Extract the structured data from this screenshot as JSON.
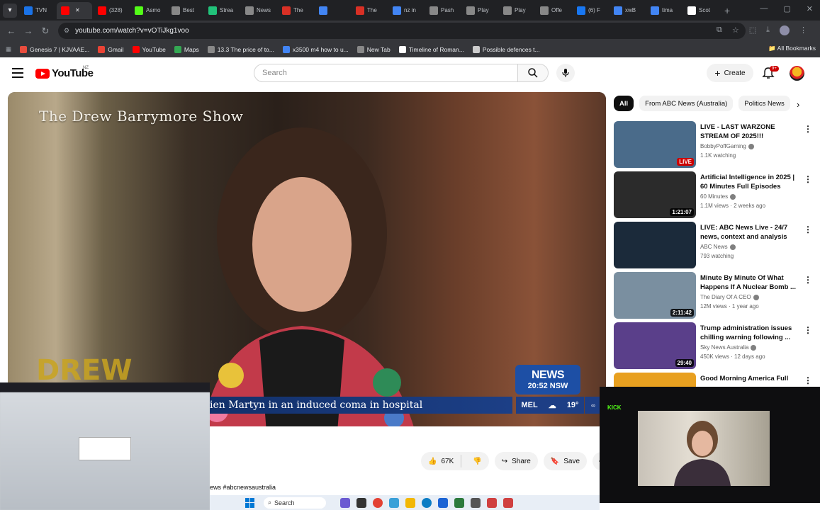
{
  "browser": {
    "tabs": [
      {
        "label": "TVN",
        "favicon_color": "#1a73e8",
        "active": false
      },
      {
        "label": "",
        "favicon_color": "#ff0000",
        "active": true
      },
      {
        "label": "(328)",
        "favicon_color": "#ff0000",
        "active": false
      },
      {
        "label": "Asmo",
        "favicon_color": "#53fc18",
        "active": false
      },
      {
        "label": "Best",
        "favicon_color": "#888888",
        "active": false
      },
      {
        "label": "Strea",
        "favicon_color": "#21c27a",
        "active": false
      },
      {
        "label": "News",
        "favicon_color": "#888888",
        "active": false
      },
      {
        "label": "The",
        "favicon_color": "#d93025",
        "active": false
      },
      {
        "label": "",
        "favicon_color": "#4285f4",
        "active": false
      },
      {
        "label": "The",
        "favicon_color": "#d93025",
        "active": false
      },
      {
        "label": "nz in",
        "favicon_color": "#4285f4",
        "active": false
      },
      {
        "label": "Pash",
        "favicon_color": "#888888",
        "active": false
      },
      {
        "label": "Play",
        "favicon_color": "#888888",
        "active": false
      },
      {
        "label": "Play",
        "favicon_color": "#888888",
        "active": false
      },
      {
        "label": "Offe",
        "favicon_color": "#888888",
        "active": false
      },
      {
        "label": "(6) F",
        "favicon_color": "#1877f2",
        "active": false
      },
      {
        "label": "xwB",
        "favicon_color": "#4285f4",
        "active": false
      },
      {
        "label": "tima",
        "favicon_color": "#4285f4",
        "active": false
      },
      {
        "label": "Scot",
        "favicon_color": "#ffffff",
        "active": false
      }
    ],
    "url": "youtube.com/watch?v=vOTiJkg1voo",
    "bookmarks": [
      {
        "label": "Genesis 7 | KJVAAE...",
        "color": "#e84c3d"
      },
      {
        "label": "Gmail",
        "color": "#ea4335"
      },
      {
        "label": "YouTube",
        "color": "#ff0000"
      },
      {
        "label": "Maps",
        "color": "#34a853"
      },
      {
        "label": "13.3 The price of to...",
        "color": "#888888"
      },
      {
        "label": "x3500 m4 how to u...",
        "color": "#4285f4"
      },
      {
        "label": "New Tab",
        "color": "#888888"
      },
      {
        "label": "Timeline of Roman...",
        "color": "#ffffff"
      },
      {
        "label": "Possible defences t...",
        "color": "#cccccc"
      }
    ],
    "all_bookmarks": "All Bookmarks"
  },
  "youtube": {
    "logo": "YouTube",
    "region": "NZ",
    "search_placeholder": "Search",
    "create_label": "Create",
    "notif_count": "9+"
  },
  "video": {
    "show_title": "The Drew Barrymore Show",
    "drew_logo": "DREW",
    "abc_news": "NEWS",
    "abc_time": "20:52 NSW",
    "lower_third": "Celeste Barber... ...ien Martyn in an induced coma in hospital",
    "lower_third_visible": "ien Martyn in an induced coma in hospital",
    "weather_city": "MEL",
    "weather_temp": "19°"
  },
  "actions": {
    "likes": "67K",
    "share": "Share",
    "save": "Save"
  },
  "description_snippet": "ews #abcnewsaustralia",
  "chips": [
    {
      "label": "All",
      "active": true
    },
    {
      "label": "From ABC News (Australia)",
      "active": false
    },
    {
      "label": "Politics News",
      "active": false
    }
  ],
  "recommendations": [
    {
      "title": "LIVE - LAST WARZONE STREAM OF 2025!!!",
      "channel": "BobbyPoffGaming",
      "meta": "1.1K watching",
      "badge": "LIVE",
      "live": true,
      "thumb_color": "#4a6b8a"
    },
    {
      "title": "Artificial Intelligence in 2025 | 60 Minutes Full Episodes",
      "channel": "60 Minutes",
      "meta": "1.1M views · 2 weeks ago",
      "badge": "1:21:07",
      "live": false,
      "thumb_color": "#2b2b2b"
    },
    {
      "title": "LIVE: ABC News Live - 24/7 news, context and analysis",
      "channel": "ABC News",
      "meta": "793 watching",
      "badge": "",
      "live": false,
      "thumb_color": "#1b2a3a"
    },
    {
      "title": "Minute By Minute Of What Happens If A Nuclear Bomb ...",
      "channel": "The Diary Of A CEO",
      "meta": "12M views · 1 year ago",
      "badge": "2:11:42",
      "live": false,
      "thumb_color": "#7a8fa0"
    },
    {
      "title": "Trump administration issues chilling warning following ...",
      "channel": "Sky News Australia",
      "meta": "450K views · 12 days ago",
      "badge": "29:40",
      "live": false,
      "thumb_color": "#5a3f8a"
    },
    {
      "title": "Good Morning America Full",
      "channel": "",
      "meta": "",
      "badge": "",
      "live": false,
      "thumb_color": "#e8a020"
    }
  ],
  "taskbar": {
    "search": "Search"
  },
  "overlay": {
    "kick": "KICK"
  }
}
